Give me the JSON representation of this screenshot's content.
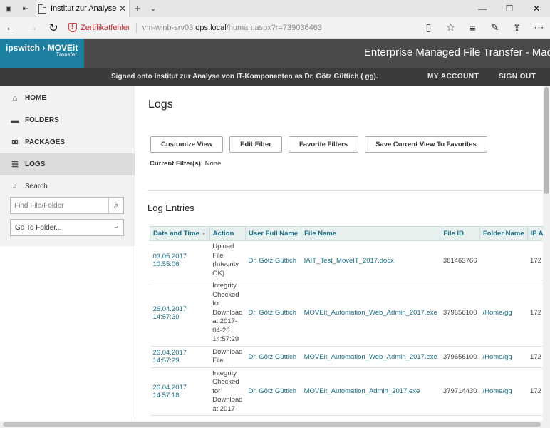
{
  "browser": {
    "tab_title": "Institut zur Analyse von",
    "cert_warning": "Zertifikatfehler",
    "url_prefix": "vm-winb-srv03.",
    "url_host": "ops.local",
    "url_path": "/human.aspx?r=739036463"
  },
  "header": {
    "logo_brand": "ipswitch",
    "logo_product": "MOVEit",
    "logo_sub": "Transfer",
    "app_title": "Enterprise Managed File Transfer - Mad",
    "signed_prefix": "Signed onto",
    "org": "Institut zur Analyse von IT-Komponenten",
    "as": "as",
    "user": "Dr. Götz Güttich",
    "user_id": "( gg).",
    "my_account": "MY ACCOUNT",
    "sign_out": "SIGN OUT"
  },
  "sidebar": {
    "items": [
      {
        "label": "HOME",
        "icon": "home-icon"
      },
      {
        "label": "FOLDERS",
        "icon": "folder-icon"
      },
      {
        "label": "PACKAGES",
        "icon": "envelope-icon"
      },
      {
        "label": "LOGS",
        "icon": "list-icon"
      },
      {
        "label": "Search",
        "icon": "search-icon"
      }
    ],
    "find_placeholder": "Find File/Folder",
    "goto_folder": "Go To Folder..."
  },
  "main": {
    "title": "Logs",
    "buttons": [
      "Customize View",
      "Edit Filter",
      "Favorite Filters",
      "Save Current View To Favorites"
    ],
    "filters_label": "Current Filter(s):",
    "filters_value": "None",
    "section_title": "Log Entries",
    "columns": [
      "Date and Time",
      "Action",
      "User Full Name",
      "File Name",
      "File ID",
      "Folder Name",
      "IP A"
    ],
    "rows": [
      {
        "date": "03.05.2017",
        "time": "10:55:06",
        "action": [
          "Upload",
          "File",
          "(Integrity",
          "OK)"
        ],
        "user": "Dr. Götz Güttich",
        "file": "IAIT_Test_MoveIT_2017.docx",
        "file_id": "381463766",
        "folder": "",
        "ip": "172"
      },
      {
        "date": "26.04.2017",
        "time": "14:57:30",
        "action": [
          "Integrity",
          "Checked",
          "for",
          "Download",
          "at 2017-",
          "04-26",
          "14:57:29"
        ],
        "user": "Dr. Götz Güttich",
        "file": "MOVEit_Automation_Web_Admin_2017.exe",
        "file_id": "379656100",
        "folder": "/Home/gg",
        "ip": "172"
      },
      {
        "date": "26.04.2017",
        "time": "14:57:29",
        "action": [
          "Download",
          "File"
        ],
        "user": "Dr. Götz Güttich",
        "file": "MOVEit_Automation_Web_Admin_2017.exe",
        "file_id": "379656100",
        "folder": "/Home/gg",
        "ip": "172"
      },
      {
        "date": "26.04.2017",
        "time": "14:57:18",
        "action": [
          "Integrity",
          "Checked",
          "for",
          "Download",
          "at 2017-"
        ],
        "user": "Dr. Götz Güttich",
        "file": "MOVEit_Automation_Admin_2017.exe",
        "file_id": "379714430",
        "folder": "/Home/gg",
        "ip": "172"
      }
    ]
  }
}
